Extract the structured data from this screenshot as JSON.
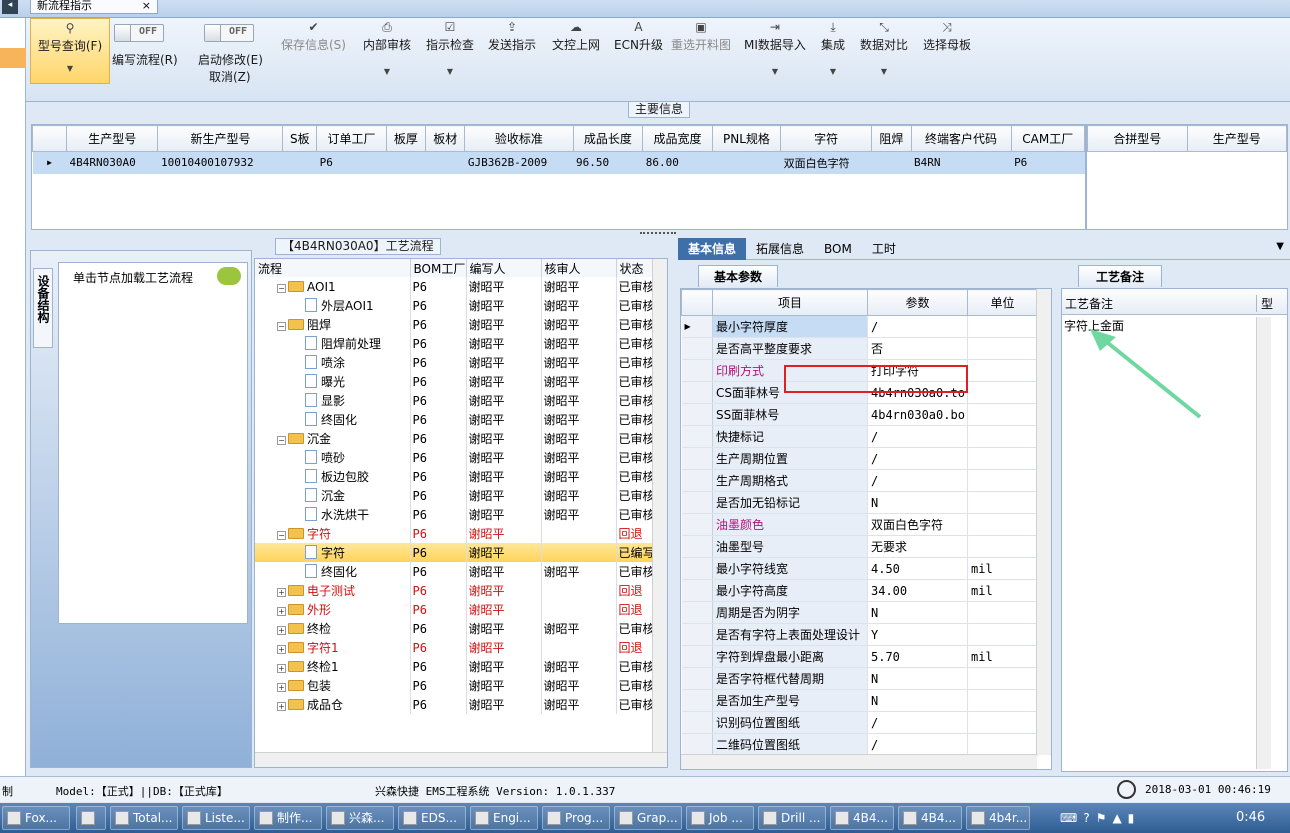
{
  "window": {
    "tab_title": "新流程指示",
    "close_glyph": "×"
  },
  "ribbon": {
    "query": {
      "label": "型号查询(F)",
      "icon": "search-icon"
    },
    "write_flow": {
      "toggle": "OFF",
      "label": "编写流程(R)"
    },
    "start_modify": {
      "toggle": "OFF",
      "label": "启动修改(E)",
      "sub": "取消(Z)"
    },
    "save_info": {
      "label": "保存信息(S)",
      "icon": "check-icon"
    },
    "internal_review": {
      "label": "内部审核",
      "icon": "printer-icon"
    },
    "instr_check": {
      "label": "指示检查",
      "icon": "checkbox-icon"
    },
    "send_instr": {
      "label": "发送指示",
      "icon": "upload-icon"
    },
    "upload_web": {
      "label": "文控上网",
      "icon": "cloud-upload-icon"
    },
    "ecn_upgrade": {
      "label": "ECN升级",
      "icon": "font-icon"
    },
    "reselect_cut": {
      "label": "重选开料图",
      "icon": "image-icon"
    },
    "mi_import": {
      "label": "MI数据导入",
      "icon": "import-icon"
    },
    "integrate": {
      "label": "集成",
      "icon": "download-icon"
    },
    "data_compare": {
      "label": "数据对比",
      "icon": "compress-icon"
    },
    "select_master": {
      "label": "选择母板",
      "icon": "shuffle-icon"
    }
  },
  "main_info": {
    "title": "主要信息",
    "columns": [
      "生产型号",
      "新生产型号",
      "S板",
      "订单工厂",
      "板厚",
      "板材",
      "验收标准",
      "成品长度",
      "成品宽度",
      "PNL规格",
      "字符",
      "阻焊",
      "终端客户代码",
      "CAM工厂"
    ],
    "row": [
      "4B4RN030A0",
      "10010400107932",
      "",
      "P6",
      "",
      "",
      "GJB362B-2009",
      "96.50",
      "86.00",
      "",
      "双面白色字符",
      "",
      "B4RN",
      "P6"
    ],
    "merge_columns": [
      "合拼型号",
      "生产型号"
    ]
  },
  "left_panel": {
    "vertical_tab": "设备结构",
    "hint": "单击节点加载工艺流程"
  },
  "flow": {
    "title": "【4B4RN030A0】工艺流程",
    "columns": [
      "流程",
      "BOM工厂",
      "编写人",
      "核审人",
      "状态"
    ],
    "rows": [
      {
        "indent": 1,
        "type": "folder",
        "exp": "−",
        "name": "AOI1",
        "bom": "P6",
        "writer": "谢昭平",
        "reviewer": "谢昭平",
        "status": "已审核",
        "red": false
      },
      {
        "indent": 2,
        "type": "doc",
        "name": "外层AOI1",
        "bom": "P6",
        "writer": "谢昭平",
        "reviewer": "谢昭平",
        "status": "已审核",
        "red": false
      },
      {
        "indent": 1,
        "type": "folder",
        "exp": "−",
        "name": "阻焊",
        "bom": "P6",
        "writer": "谢昭平",
        "reviewer": "谢昭平",
        "status": "已审核",
        "red": false
      },
      {
        "indent": 2,
        "type": "doc",
        "name": "阻焊前处理",
        "bom": "P6",
        "writer": "谢昭平",
        "reviewer": "谢昭平",
        "status": "已审核",
        "red": false
      },
      {
        "indent": 2,
        "type": "doc",
        "name": "喷涂",
        "bom": "P6",
        "writer": "谢昭平",
        "reviewer": "谢昭平",
        "status": "已审核",
        "red": false
      },
      {
        "indent": 2,
        "type": "doc",
        "name": "曝光",
        "bom": "P6",
        "writer": "谢昭平",
        "reviewer": "谢昭平",
        "status": "已审核",
        "red": false
      },
      {
        "indent": 2,
        "type": "doc",
        "name": "显影",
        "bom": "P6",
        "writer": "谢昭平",
        "reviewer": "谢昭平",
        "status": "已审核",
        "red": false
      },
      {
        "indent": 2,
        "type": "doc",
        "name": "终固化",
        "bom": "P6",
        "writer": "谢昭平",
        "reviewer": "谢昭平",
        "status": "已审核",
        "red": false
      },
      {
        "indent": 1,
        "type": "folder",
        "exp": "−",
        "name": "沉金",
        "bom": "P6",
        "writer": "谢昭平",
        "reviewer": "谢昭平",
        "status": "已审核",
        "red": false
      },
      {
        "indent": 2,
        "type": "doc",
        "name": "喷砂",
        "bom": "P6",
        "writer": "谢昭平",
        "reviewer": "谢昭平",
        "status": "已审核",
        "red": false
      },
      {
        "indent": 2,
        "type": "doc",
        "name": "板边包胶",
        "bom": "P6",
        "writer": "谢昭平",
        "reviewer": "谢昭平",
        "status": "已审核",
        "red": false
      },
      {
        "indent": 2,
        "type": "doc",
        "name": "沉金",
        "bom": "P6",
        "writer": "谢昭平",
        "reviewer": "谢昭平",
        "status": "已审核",
        "red": false
      },
      {
        "indent": 2,
        "type": "doc",
        "name": "水洗烘干",
        "bom": "P6",
        "writer": "谢昭平",
        "reviewer": "谢昭平",
        "status": "已审核",
        "red": false
      },
      {
        "indent": 1,
        "type": "folder",
        "exp": "−",
        "name": "字符",
        "bom": "P6",
        "writer": "谢昭平",
        "reviewer": "",
        "status": "回退",
        "red": true
      },
      {
        "indent": 2,
        "type": "doc",
        "name": "字符",
        "bom": "P6",
        "writer": "谢昭平",
        "reviewer": "",
        "status": "已编写",
        "red": false,
        "selected": true
      },
      {
        "indent": 2,
        "type": "doc",
        "name": "终固化",
        "bom": "P6",
        "writer": "谢昭平",
        "reviewer": "谢昭平",
        "status": "已审核",
        "red": false
      },
      {
        "indent": 1,
        "type": "folder",
        "exp": "+",
        "name": "电子测试",
        "bom": "P6",
        "writer": "谢昭平",
        "reviewer": "",
        "status": "回退",
        "red": true
      },
      {
        "indent": 1,
        "type": "folder",
        "exp": "+",
        "name": "外形",
        "bom": "P6",
        "writer": "谢昭平",
        "reviewer": "",
        "status": "回退",
        "red": true
      },
      {
        "indent": 1,
        "type": "folder",
        "exp": "+",
        "name": "终检",
        "bom": "P6",
        "writer": "谢昭平",
        "reviewer": "谢昭平",
        "status": "已审核",
        "red": false
      },
      {
        "indent": 1,
        "type": "folder",
        "exp": "+",
        "name": "字符1",
        "bom": "P6",
        "writer": "谢昭平",
        "reviewer": "",
        "status": "回退",
        "red": true
      },
      {
        "indent": 1,
        "type": "folder",
        "exp": "+",
        "name": "终检1",
        "bom": "P6",
        "writer": "谢昭平",
        "reviewer": "谢昭平",
        "status": "已审核",
        "red": false
      },
      {
        "indent": 1,
        "type": "folder",
        "exp": "+",
        "name": "包装",
        "bom": "P6",
        "writer": "谢昭平",
        "reviewer": "谢昭平",
        "status": "已审核",
        "red": false
      },
      {
        "indent": 1,
        "type": "folder",
        "exp": "+",
        "name": "成品仓",
        "bom": "P6",
        "writer": "谢昭平",
        "reviewer": "谢昭平",
        "status": "已审核",
        "red": false
      }
    ]
  },
  "detail_tabs": [
    "基本信息",
    "拓展信息",
    "BOM",
    "工时"
  ],
  "basic_params": {
    "title": "基本参数",
    "columns": [
      "项目",
      "参数",
      "单位"
    ],
    "rows": [
      {
        "k": "最小字符厚度",
        "v": "/",
        "u": "",
        "mag": false
      },
      {
        "k": "是否高平整度要求",
        "v": "否",
        "u": "",
        "mag": false
      },
      {
        "k": "印刷方式",
        "v": "打印字符",
        "u": "",
        "mag": true,
        "highlight": true
      },
      {
        "k": "CS面菲林号",
        "v": "4b4rn030a0.to",
        "u": "",
        "mag": false
      },
      {
        "k": "SS面菲林号",
        "v": "4b4rn030a0.bo",
        "u": "",
        "mag": false
      },
      {
        "k": "快捷标记",
        "v": "/",
        "u": "",
        "mag": false
      },
      {
        "k": "生产周期位置",
        "v": "/",
        "u": "",
        "mag": false
      },
      {
        "k": "生产周期格式",
        "v": "/",
        "u": "",
        "mag": false
      },
      {
        "k": "是否加无铅标记",
        "v": "N",
        "u": "",
        "mag": false
      },
      {
        "k": "油墨颜色",
        "v": "双面白色字符",
        "u": "",
        "mag": true
      },
      {
        "k": "油墨型号",
        "v": "无要求",
        "u": "",
        "mag": false
      },
      {
        "k": "最小字符线宽",
        "v": "4.50",
        "u": "mil",
        "mag": false
      },
      {
        "k": "最小字符高度",
        "v": "34.00",
        "u": "mil",
        "mag": false
      },
      {
        "k": "周期是否为阴字",
        "v": "N",
        "u": "",
        "mag": false
      },
      {
        "k": "是否有字符上表面处理设计",
        "v": "Y",
        "u": "",
        "mag": false
      },
      {
        "k": "字符到焊盘最小距离",
        "v": "5.70",
        "u": "mil",
        "mag": false
      },
      {
        "k": "是否字符框代替周期",
        "v": "N",
        "u": "",
        "mag": false
      },
      {
        "k": "是否加生产型号",
        "v": "N",
        "u": "",
        "mag": false
      },
      {
        "k": "识别码位置图纸",
        "v": "/",
        "u": "",
        "mag": false
      },
      {
        "k": "二维码位置图纸",
        "v": "/",
        "u": "",
        "mag": false
      }
    ]
  },
  "process_notes": {
    "tab": "工艺备注",
    "col": "工艺备注",
    "col2": "型",
    "content": "字符上金面"
  },
  "status_bar": {
    "left": "制",
    "model": "Model:【正式】||DB:【正式库】",
    "system": "兴森快捷 EMS工程系统 Version: 1.0.1.337",
    "datetime": "2018-03-01 00:46:19"
  },
  "taskbar": {
    "items": [
      "Fox...",
      "",
      "Total...",
      "Liste...",
      "制作...",
      "兴森...",
      "EDS...",
      "Engi...",
      "Prog...",
      "Grap...",
      "Job ...",
      "Drill ...",
      "4B4...",
      "4B4...",
      "4b4r..."
    ],
    "clock": "0:46"
  },
  "colors": {
    "accent": "#3e6fa8",
    "highlight_box": "#e02020",
    "arrow": "#6fd8a0",
    "selected_row": "#ffd86a"
  }
}
